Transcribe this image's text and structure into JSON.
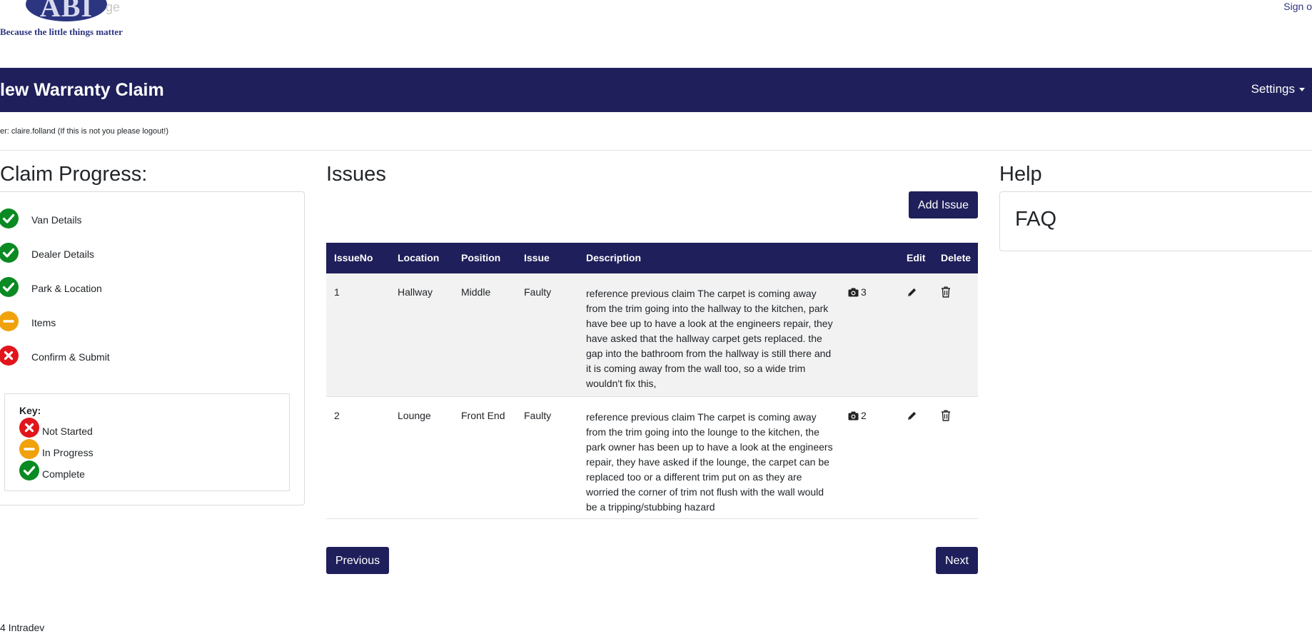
{
  "header": {
    "logo_text": "ABI",
    "logo_ghost_text": "ge",
    "tagline": "Because the little things matter",
    "signout_label": "Sign o"
  },
  "navbar": {
    "title": "lew Warranty Claim",
    "settings_label": "Settings"
  },
  "user_line": "er: claire.folland (If this is not you please logout!)",
  "progress": {
    "title": "Claim Progress:",
    "steps": [
      {
        "label": "Van Details",
        "status": "complete"
      },
      {
        "label": "Dealer Details",
        "status": "complete"
      },
      {
        "label": "Park & Location",
        "status": "complete"
      },
      {
        "label": "Items",
        "status": "in-progress"
      },
      {
        "label": "Confirm & Submit",
        "status": "not-started"
      }
    ],
    "key": {
      "title": "Key:",
      "items": [
        {
          "label": "Not Started",
          "status": "not-started"
        },
        {
          "label": "In Progress",
          "status": "in-progress"
        },
        {
          "label": "Complete",
          "status": "complete"
        }
      ]
    }
  },
  "issues": {
    "title": "Issues",
    "add_label": "Add Issue",
    "columns": [
      "IssueNo",
      "Location",
      "Position",
      "Issue",
      "Description",
      "Edit",
      "Delete"
    ],
    "rows": [
      {
        "issue_no": "1",
        "location": "Hallway",
        "position": "Middle",
        "issue": "Faulty",
        "description": "reference previous claim The carpet is coming away from the trim going into the hallway to the kitchen, park have bee up to have a look at the engineers repair, they have asked that the hallway carpet gets replaced. the gap into the bathroom from the hallway is still there and it is coming away from the wall too, so a wide trim wouldn't fix this,",
        "photos": "3"
      },
      {
        "issue_no": "2",
        "location": "Lounge",
        "position": "Front End",
        "issue": "Faulty",
        "description": "reference previous claim The carpet is coming away from the trim going into the lounge to the kitchen, the park owner has been up to have a look at the engineers repair, they have asked if the lounge, the carpet can be replaced too or a different trim put on as they are worried the corner of trim not flush with the wall would be a tripping/stubbing hazard",
        "photos": "2"
      }
    ],
    "previous_label": "Previous",
    "next_label": "Next"
  },
  "help": {
    "title": "Help",
    "faq_label": "FAQ"
  },
  "footer": "4 Intradev",
  "colors": {
    "brand_navy": "#1f1f5b",
    "complete": "#0a8a22",
    "in_progress": "#f0a20c",
    "not_started": "#e0161c"
  },
  "icons": {
    "complete": "check-circle-icon",
    "in_progress": "minus-circle-icon",
    "not_started": "x-circle-icon",
    "photos": "camera-icon",
    "edit": "pencil-icon",
    "delete": "trash-icon"
  }
}
